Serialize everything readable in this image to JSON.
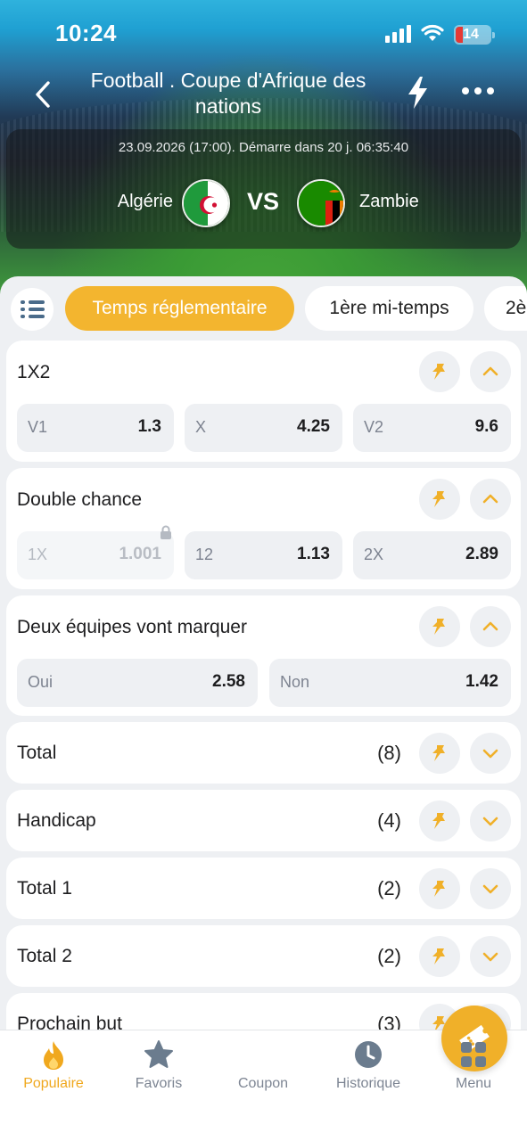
{
  "status_bar": {
    "time": "10:24",
    "battery": "14"
  },
  "header": {
    "title": "Football . Coupe d'Afrique des nations",
    "icons": {
      "back": "chevron-left-icon",
      "live": "lightning-icon",
      "more": "more-icon"
    }
  },
  "match": {
    "date_text": "23.09.2026 (17:00). Démarre dans 20 j. 06:35:40",
    "team1": "Algérie",
    "vs": "VS",
    "team2": "Zambie"
  },
  "tabs": [
    {
      "label": "Temps réglementaire",
      "active": true
    },
    {
      "label": "1ère mi-temps",
      "active": false
    },
    {
      "label": "2è",
      "active": false
    }
  ],
  "markets": [
    {
      "title": "1X2",
      "expanded": true,
      "odds": [
        {
          "key": "V1",
          "value": "1.3"
        },
        {
          "key": "X",
          "value": "4.25"
        },
        {
          "key": "V2",
          "value": "9.6"
        }
      ]
    },
    {
      "title": "Double chance",
      "expanded": true,
      "odds": [
        {
          "key": "1X",
          "value": "1.001",
          "locked": true
        },
        {
          "key": "12",
          "value": "1.13"
        },
        {
          "key": "2X",
          "value": "2.89"
        }
      ]
    },
    {
      "title": "Deux équipes vont marquer",
      "expanded": true,
      "odds": [
        {
          "key": "Oui",
          "value": "2.58"
        },
        {
          "key": "Non",
          "value": "1.42"
        }
      ]
    },
    {
      "title": "Total",
      "count": "(8)",
      "expanded": false
    },
    {
      "title": "Handicap",
      "count": "(4)",
      "expanded": false
    },
    {
      "title": "Total 1",
      "count": "(2)",
      "expanded": false
    },
    {
      "title": "Total 2",
      "count": "(2)",
      "expanded": false
    },
    {
      "title": "Prochain but",
      "count": "(3)",
      "expanded": false
    }
  ],
  "bottom_nav": [
    {
      "label": "Populaire",
      "icon": "flame-icon",
      "active": true
    },
    {
      "label": "Favoris",
      "icon": "star-icon",
      "active": false
    },
    {
      "label": "Coupon",
      "icon": "ticket-icon",
      "active": false
    },
    {
      "label": "Historique",
      "icon": "clock-icon",
      "active": false
    },
    {
      "label": "Menu",
      "icon": "grid-icon",
      "active": false
    }
  ],
  "colors": {
    "accent": "#f3b52f",
    "background": "#eef0f3",
    "text": "#1d1d1f",
    "muted": "#7d8390"
  }
}
